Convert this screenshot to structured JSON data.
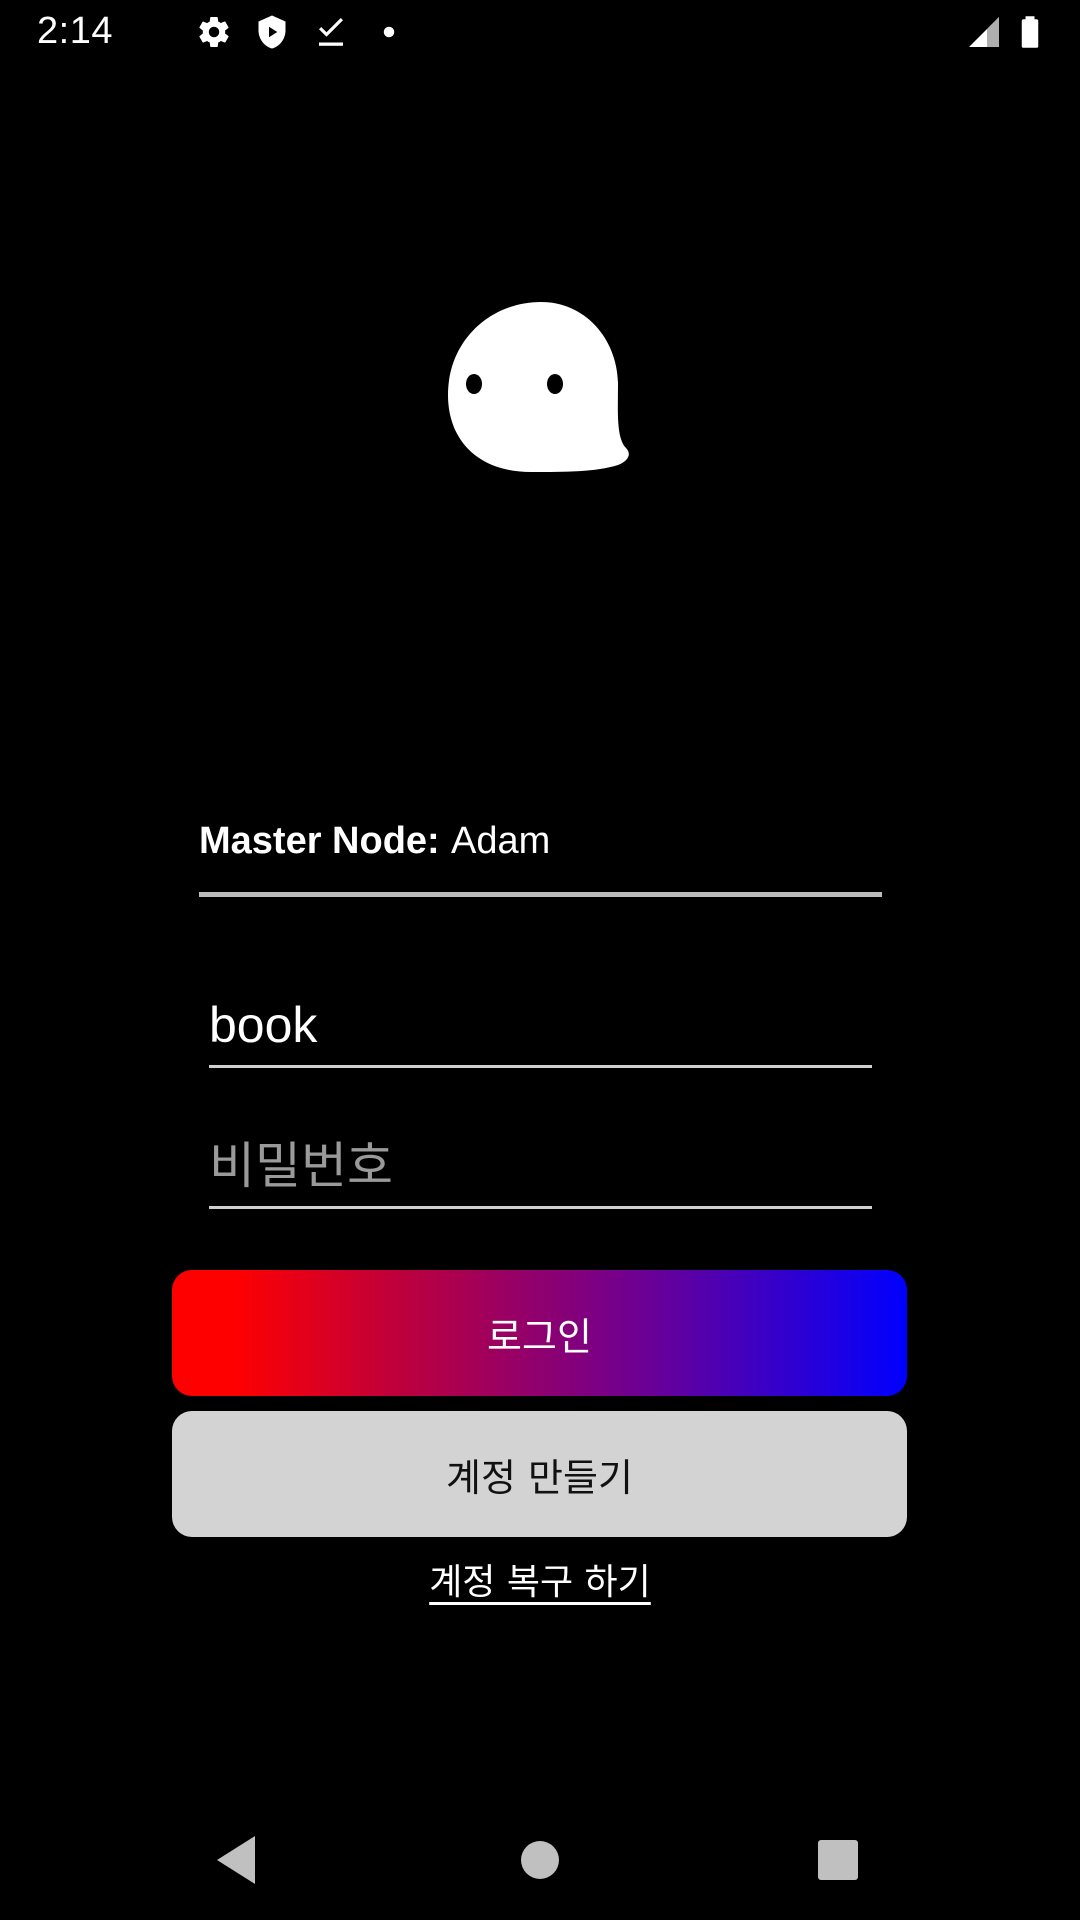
{
  "status_bar": {
    "time": "2:14",
    "icons": [
      "gear-icon",
      "shield-icon",
      "download-done-icon",
      "notification-dot-icon",
      "cell-signal-icon",
      "battery-icon"
    ]
  },
  "logo": {
    "icon": "ghost-icon"
  },
  "master_node": {
    "label": "Master Node:",
    "value": "Adam"
  },
  "form": {
    "username_value": "book",
    "password_placeholder": "비밀번호",
    "password_value": ""
  },
  "buttons": {
    "login_label": "로그인",
    "create_account_label": "계정 만들기",
    "recover_account_label": "계정 복구 하기"
  },
  "nav_bar": {
    "icons": [
      "back-icon",
      "home-icon",
      "recents-icon"
    ]
  },
  "colors": {
    "background": "#000000",
    "login_gradient_start": "#ff0000",
    "login_gradient_end": "#0000ff",
    "create_button_bg": "#d3d3d3"
  }
}
